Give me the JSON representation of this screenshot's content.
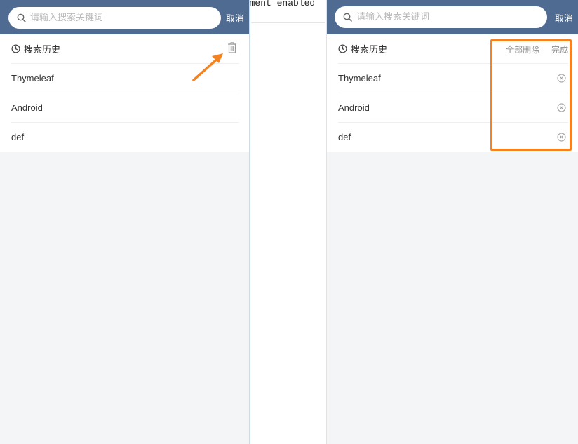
{
  "background_code_text": "tement enabled",
  "search": {
    "placeholder": "请输入搜索关键词"
  },
  "cancel_label": "取消",
  "history_title": "搜索历史",
  "delete_all_label": "全部删除",
  "done_label": "完成",
  "history_items": [
    "Thymeleaf",
    "Android",
    "def"
  ],
  "colors": {
    "header": "#4f6b91",
    "page_bg": "#f4f5f7",
    "annotation": "#f58220"
  },
  "icons": {
    "search": "search-icon",
    "clock": "clock-icon",
    "trash": "trash-icon",
    "remove": "close-circle-icon"
  }
}
